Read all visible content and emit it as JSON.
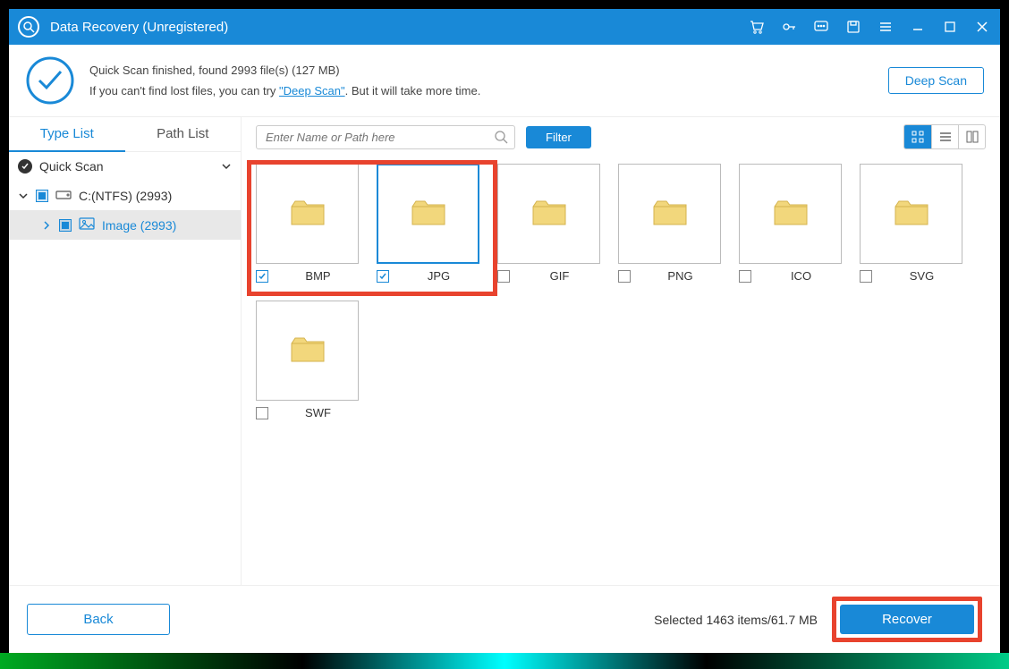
{
  "titlebar": {
    "app_title": "Data Recovery (Unregistered)"
  },
  "status": {
    "line1": "Quick Scan finished, found 2993 file(s) (127 MB)",
    "line2_pre": "If you can't find lost files, you can try ",
    "deep_link": "\"Deep Scan\"",
    "line2_post": ". But it will take more time.",
    "deep_scan_btn": "Deep Scan"
  },
  "sidebar": {
    "tab_type": "Type List",
    "tab_path": "Path List",
    "root": "Quick Scan",
    "drive": "C:(NTFS) (2993)",
    "image": "Image (2993)"
  },
  "toolbar": {
    "search_placeholder": "Enter Name or Path here",
    "filter": "Filter"
  },
  "folders": {
    "bmp": "BMP",
    "jpg": "JPG",
    "gif": "GIF",
    "png": "PNG",
    "ico": "ICO",
    "svg": "SVG",
    "swf": "SWF"
  },
  "footer": {
    "back": "Back",
    "selected": "Selected 1463 items/61.7 MB",
    "recover": "Recover"
  }
}
